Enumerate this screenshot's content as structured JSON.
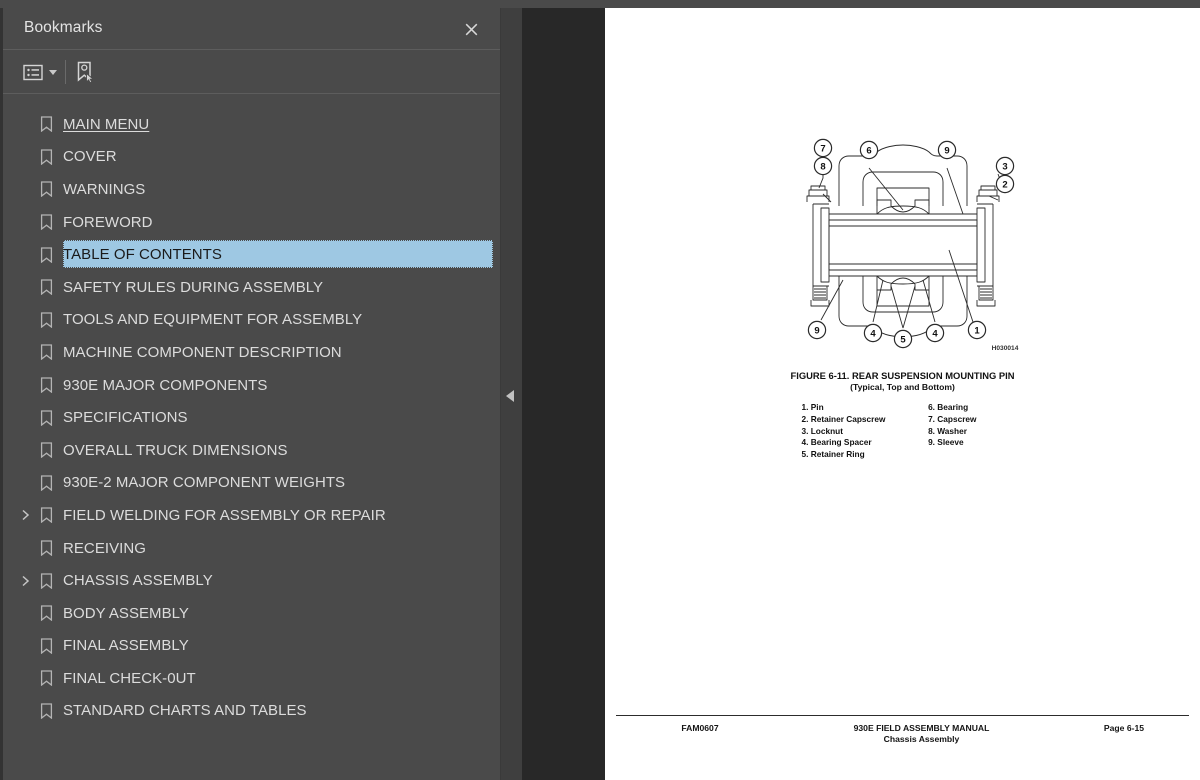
{
  "panel": {
    "title": "Bookmarks",
    "close_icon": "close-icon",
    "toolbar": {
      "options_icon": "list-options-icon",
      "new_bookmark_icon": "new-bookmark-icon"
    },
    "items": [
      {
        "label": "MAIN MENU",
        "expandable": false,
        "selected": false,
        "link": true
      },
      {
        "label": "COVER",
        "expandable": false,
        "selected": false,
        "link": false
      },
      {
        "label": "WARNINGS",
        "expandable": false,
        "selected": false,
        "link": false
      },
      {
        "label": "FOREWORD",
        "expandable": false,
        "selected": false,
        "link": false
      },
      {
        "label": "TABLE OF CONTENTS",
        "expandable": false,
        "selected": true,
        "link": false
      },
      {
        "label": "SAFETY RULES DURING ASSEMBLY",
        "expandable": false,
        "selected": false,
        "link": false
      },
      {
        "label": "TOOLS AND EQUIPMENT FOR ASSEMBLY",
        "expandable": false,
        "selected": false,
        "link": false
      },
      {
        "label": "MACHINE COMPONENT DESCRIPTION",
        "expandable": false,
        "selected": false,
        "link": false
      },
      {
        "label": "930E MAJOR COMPONENTS",
        "expandable": false,
        "selected": false,
        "link": false
      },
      {
        "label": "SPECIFICATIONS",
        "expandable": false,
        "selected": false,
        "link": false
      },
      {
        "label": "OVERALL TRUCK DIMENSIONS",
        "expandable": false,
        "selected": false,
        "link": false
      },
      {
        "label": "930E-2 MAJOR COMPONENT WEIGHTS",
        "expandable": false,
        "selected": false,
        "link": false
      },
      {
        "label": "FIELD WELDING FOR ASSEMBLY OR REPAIR",
        "expandable": true,
        "selected": false,
        "link": false
      },
      {
        "label": "RECEIVING",
        "expandable": false,
        "selected": false,
        "link": false
      },
      {
        "label": "CHASSIS ASSEMBLY",
        "expandable": true,
        "selected": false,
        "link": false
      },
      {
        "label": "BODY ASSEMBLY",
        "expandable": false,
        "selected": false,
        "link": false
      },
      {
        "label": "FINAL ASSEMBLY",
        "expandable": false,
        "selected": false,
        "link": false
      },
      {
        "label": "FINAL CHECK-0UT",
        "expandable": false,
        "selected": false,
        "link": false
      },
      {
        "label": "STANDARD CHARTS AND TABLES",
        "expandable": false,
        "selected": false,
        "link": false
      }
    ]
  },
  "collapse": {
    "icon": "collapse-left-arrow-icon"
  },
  "document": {
    "figure": {
      "title": "FIGURE 6-11. REAR SUSPENSION MOUNTING PIN",
      "subtitle": "(Typical, Top and Bottom)",
      "drawing_id": "H030014",
      "callouts": [
        "7",
        "8",
        "6",
        "9",
        "3",
        "2",
        "9",
        "4",
        "5",
        "4",
        "1"
      ],
      "parts_left": [
        "1. Pin",
        "2. Retainer Capscrew",
        "3. Locknut",
        "4. Bearing Spacer",
        "5. Retainer Ring"
      ],
      "parts_right": [
        "6. Bearing",
        "7. Capscrew",
        "8. Washer",
        "9. Sleeve"
      ]
    },
    "footer": {
      "left": "FAM0607",
      "center_line1": "930E FIELD ASSEMBLY MANUAL",
      "center_line2": "Chassis Assembly",
      "right": "Page 6-15"
    }
  },
  "colors": {
    "panel_bg": "#4a4a4a",
    "viewer_bg": "#282828",
    "selection": "#9ec8e3",
    "page_bg": "#ffffff"
  }
}
